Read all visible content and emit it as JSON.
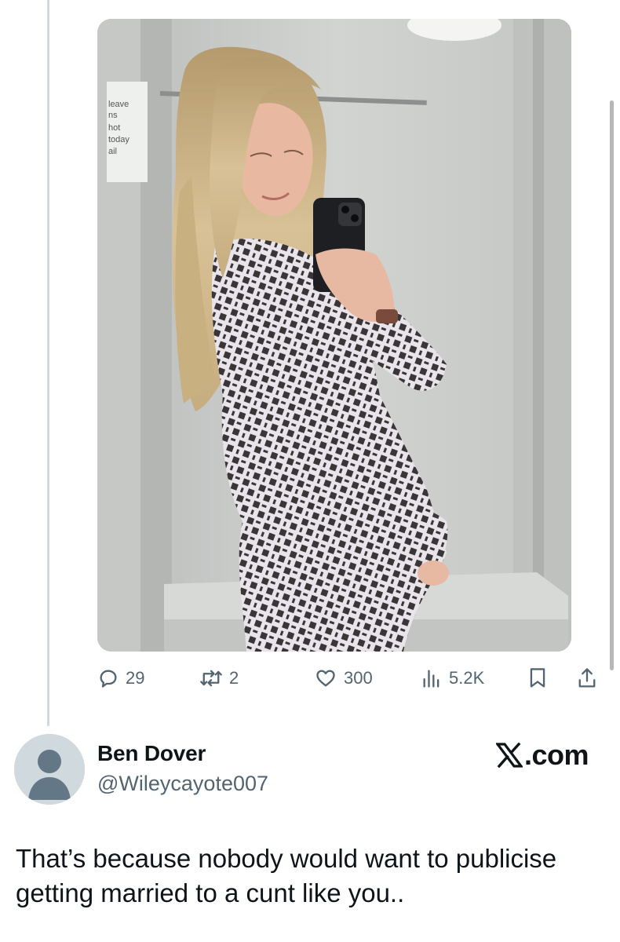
{
  "tweet": {
    "media": {
      "sign_lines": [
        "leave",
        "ns",
        "hot",
        "today",
        "ail"
      ]
    },
    "actions": {
      "replies": "29",
      "reposts": "2",
      "likes": "300",
      "views": "5.2K"
    }
  },
  "reply": {
    "display_name": "Ben Dover",
    "handle": "@Wileycayote007",
    "brand_text": ".com",
    "text": "That’s because nobody would want to publicise getting married to a cunt like you.."
  },
  "colors": {
    "text_primary": "#0f1419",
    "text_secondary": "#536471",
    "thread_line": "#cfd9de",
    "avatar_bg": "#cfd9de",
    "avatar_fg": "#647787"
  },
  "icons": [
    "reply-icon",
    "repost-icon",
    "like-icon",
    "views-icon",
    "bookmark-icon",
    "share-icon",
    "x-logo-icon",
    "default-avatar-icon"
  ]
}
